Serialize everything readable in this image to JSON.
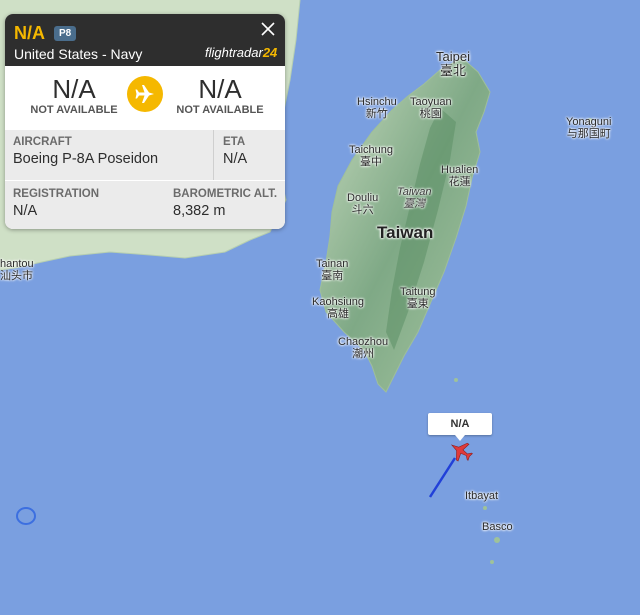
{
  "flight_card": {
    "callsign": "N/A",
    "aircraft_type_code": "P8",
    "operator": "United States - Navy",
    "brand": {
      "text": "flightradar",
      "number": "24"
    },
    "origin": {
      "code": "N/A",
      "name": "NOT AVAILABLE"
    },
    "destination": {
      "code": "N/A",
      "name": "NOT AVAILABLE"
    },
    "fields": {
      "aircraft": {
        "label": "AIRCRAFT",
        "value": "Boeing P-8A Poseidon"
      },
      "eta": {
        "label": "ETA",
        "value": "N/A"
      },
      "registration": {
        "label": "REGISTRATION",
        "value": "N/A"
      },
      "barometric_alt": {
        "label": "BAROMETRIC ALT.",
        "value": "8,382 m"
      }
    },
    "accent_color": "#f5b800",
    "header_color": "#2e2e2e"
  },
  "map": {
    "labels": {
      "taipei_en": "Taipei",
      "taipei_zh": "臺北",
      "hsinchu_en": "Hsinchu",
      "hsinchu_zh": "新竹",
      "taoyuan_en": "Taoyuan",
      "taoyuan_zh": "桃園",
      "yonaguni_en": "Yonaguni",
      "yonaguni_zh": "与那国町",
      "taichung_en": "Taichung",
      "taichung_zh": "臺中",
      "hualien_en": "Hualien",
      "hualien_zh": "花蓮",
      "taiwan_it_en": "Taiwan",
      "taiwan_it_zh": "臺灣",
      "douliu_en": "Douliu",
      "douliu_zh": "斗六",
      "taiwan_big": "Taiwan",
      "tainan_en": "Tainan",
      "tainan_zh": "臺南",
      "taitung_en": "Taitung",
      "taitung_zh": "臺東",
      "kaohsiung_en": "Kaohsiung",
      "kaohsiung_zh": "高雄",
      "chaozhou_en": "Chaozhou",
      "chaozhou_zh": "潮州",
      "shantou_en": "hantou",
      "shantou_zh": "汕头市",
      "itbayat": "Itbayat",
      "basco": "Basco"
    },
    "aircraft_marker_label": "N/A",
    "aircraft_color": "#e03a3a",
    "trail_color": "#2140d8",
    "ocean_color": "#7a9fe0"
  }
}
